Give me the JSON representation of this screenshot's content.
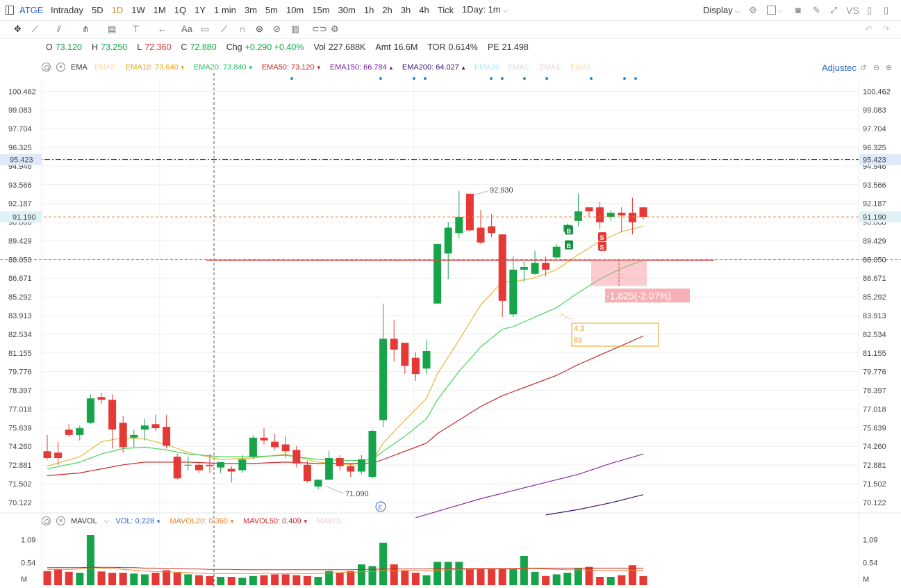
{
  "topbar": {
    "symbol": "ATGE",
    "timeframes": [
      "Intraday",
      "5D",
      "1D",
      "1W",
      "1M",
      "1Q",
      "1Y",
      "1 min",
      "3m",
      "5m",
      "10m",
      "15m",
      "30m",
      "1h",
      "2h",
      "3h",
      "4h",
      "Tick"
    ],
    "active_timeframe": "1D",
    "interval_select": "1Day: 1m",
    "display_label": "Display",
    "vs_label": "VS"
  },
  "ohlc": {
    "open_label": "O",
    "open": "73.120",
    "high_label": "H",
    "high": "73.250",
    "low_label": "L",
    "low": "72.360",
    "close_label": "C",
    "close": "72.880",
    "chg_label": "Chg",
    "chg": "+0.290",
    "chg_pct": "+0.40%",
    "vol_label": "Vol",
    "vol": "227.688K",
    "amt_label": "Amt",
    "amt": "16.6M",
    "tor_label": "TOR",
    "tor": "0.614%",
    "pe_label": "PE",
    "pe": "21.498"
  },
  "ema_legend": {
    "name": "EMA",
    "items": [
      {
        "label": "EMA5:",
        "value": "",
        "color": "#f5d9a8",
        "dir": ""
      },
      {
        "label": "EMA10:",
        "value": "73.640",
        "color": "#e8a317",
        "dir": "dn"
      },
      {
        "label": "EMA20:",
        "value": "73.840",
        "color": "#22c55e",
        "dir": "dn"
      },
      {
        "label": "EMA50:",
        "value": "73.120",
        "color": "#c62828",
        "dir": "dn"
      },
      {
        "label": "EMA150:",
        "value": "66.784",
        "color": "#7b1fa2",
        "dir": "up"
      },
      {
        "label": "EMA200:",
        "value": "64.027",
        "color": "#3b1670",
        "dir": "up"
      },
      {
        "label": "EMA30",
        "value": "",
        "color": "#b3e5f5",
        "dir": ""
      },
      {
        "label": "EMA1:",
        "value": "",
        "color": "#d8d8d8",
        "dir": ""
      },
      {
        "label": "EMA1:",
        "value": "",
        "color": "#e6cfe6",
        "dir": ""
      },
      {
        "label": "EMA1:",
        "value": "",
        "color": "#f5e0b0",
        "dir": ""
      }
    ],
    "adjusted_label": "Adjustec"
  },
  "vol_legend": {
    "name": "MAVOL",
    "items": [
      {
        "label": "VOL:",
        "value": "0.228",
        "color": "#2a62c9",
        "dir": "dn"
      },
      {
        "label": "MAVOL20:",
        "value": "0.360",
        "color": "#e8842c",
        "dir": "dn"
      },
      {
        "label": "MAVOL50:",
        "value": "0.409",
        "color": "#c62828",
        "dir": "dn"
      },
      {
        "label": "MAVOL:",
        "value": "",
        "color": "#f3c6e0",
        "dir": ""
      }
    ]
  },
  "colors": {
    "up": "#16a34a",
    "down": "#e53935",
    "grid": "#eeeeee"
  },
  "chart_data": {
    "type": "candlestick",
    "ylim": [
      69.4,
      101.3
    ],
    "y_ticks": [
      "100.462",
      "99.083",
      "97.704",
      "96.325",
      "94.946",
      "93.566",
      "92.187",
      "90.808",
      "89.429",
      "88.050",
      "86.671",
      "85.292",
      "83.913",
      "82.534",
      "81.155",
      "79.776",
      "78.397",
      "77.018",
      "75.639",
      "74.260",
      "72.881",
      "71.502",
      "70.122"
    ],
    "candles": [
      {
        "o": 73.9,
        "h": 75.1,
        "l": 73.3,
        "c": 73.4
      },
      {
        "o": 73.8,
        "h": 74.6,
        "l": 72.9,
        "c": 73.4
      },
      {
        "o": 75.5,
        "h": 75.9,
        "l": 75.0,
        "c": 75.1
      },
      {
        "o": 75.1,
        "h": 75.8,
        "l": 74.7,
        "c": 75.6
      },
      {
        "o": 76.0,
        "h": 78.1,
        "l": 75.9,
        "c": 77.8
      },
      {
        "o": 77.9,
        "h": 78.2,
        "l": 77.4,
        "c": 77.7
      },
      {
        "o": 77.7,
        "h": 78.1,
        "l": 74.1,
        "c": 75.5
      },
      {
        "o": 76.0,
        "h": 76.5,
        "l": 73.8,
        "c": 74.2
      },
      {
        "o": 74.9,
        "h": 75.5,
        "l": 74.2,
        "c": 75.1
      },
      {
        "o": 75.5,
        "h": 76.3,
        "l": 74.7,
        "c": 75.8
      },
      {
        "o": 75.9,
        "h": 76.6,
        "l": 75.4,
        "c": 75.6
      },
      {
        "o": 75.7,
        "h": 76.6,
        "l": 74.1,
        "c": 74.3
      },
      {
        "o": 73.5,
        "h": 73.7,
        "l": 71.8,
        "c": 71.9
      },
      {
        "o": 72.9,
        "h": 73.5,
        "l": 72.5,
        "c": 72.9
      },
      {
        "o": 72.9,
        "h": 73.1,
        "l": 72.3,
        "c": 72.5
      },
      {
        "o": 72.9,
        "h": 73.7,
        "l": 72.3,
        "c": 72.8
      },
      {
        "o": 72.7,
        "h": 73.1,
        "l": 72.3,
        "c": 73.1
      },
      {
        "o": 72.6,
        "h": 72.8,
        "l": 71.6,
        "c": 72.4
      },
      {
        "o": 72.5,
        "h": 73.6,
        "l": 72.3,
        "c": 73.3
      },
      {
        "o": 73.5,
        "h": 75.1,
        "l": 73.3,
        "c": 74.9
      },
      {
        "o": 74.9,
        "h": 75.6,
        "l": 74.4,
        "c": 74.7
      },
      {
        "o": 74.6,
        "h": 75.2,
        "l": 74.0,
        "c": 74.2
      },
      {
        "o": 74.4,
        "h": 75.0,
        "l": 73.4,
        "c": 73.9
      },
      {
        "o": 74.0,
        "h": 74.3,
        "l": 72.7,
        "c": 73.0
      },
      {
        "o": 72.9,
        "h": 73.2,
        "l": 71.6,
        "c": 71.7
      },
      {
        "o": 71.3,
        "h": 71.8,
        "l": 71.1,
        "c": 71.8
      },
      {
        "o": 71.8,
        "h": 73.9,
        "l": 71.8,
        "c": 73.4
      },
      {
        "o": 73.4,
        "h": 73.6,
        "l": 72.5,
        "c": 72.8
      },
      {
        "o": 72.8,
        "h": 73.0,
        "l": 72.0,
        "c": 72.4
      },
      {
        "o": 72.4,
        "h": 73.6,
        "l": 72.2,
        "c": 73.3
      },
      {
        "o": 72.0,
        "h": 75.5,
        "l": 71.9,
        "c": 75.4
      },
      {
        "o": 76.2,
        "h": 84.8,
        "l": 75.7,
        "c": 82.2
      },
      {
        "o": 82.2,
        "h": 83.6,
        "l": 80.5,
        "c": 81.4
      },
      {
        "o": 81.9,
        "h": 81.9,
        "l": 79.6,
        "c": 80.2
      },
      {
        "o": 80.8,
        "h": 81.2,
        "l": 79.1,
        "c": 79.6
      },
      {
        "o": 80.0,
        "h": 82.1,
        "l": 79.6,
        "c": 81.3
      },
      {
        "o": 84.8,
        "h": 89.2,
        "l": 84.8,
        "c": 89.2
      },
      {
        "o": 88.5,
        "h": 90.8,
        "l": 86.6,
        "c": 90.4
      },
      {
        "o": 90.0,
        "h": 93.1,
        "l": 89.6,
        "c": 91.2
      },
      {
        "o": 92.9,
        "h": 92.9,
        "l": 90.1,
        "c": 90.2
      },
      {
        "o": 90.4,
        "h": 91.7,
        "l": 89.2,
        "c": 89.3
      },
      {
        "o": 90.5,
        "h": 91.4,
        "l": 89.7,
        "c": 90.0
      },
      {
        "o": 89.9,
        "h": 89.9,
        "l": 83.8,
        "c": 85.0
      },
      {
        "o": 84.0,
        "h": 88.3,
        "l": 83.8,
        "c": 87.3
      },
      {
        "o": 87.3,
        "h": 87.9,
        "l": 86.4,
        "c": 87.5
      },
      {
        "o": 87.0,
        "h": 88.7,
        "l": 86.9,
        "c": 87.8
      },
      {
        "o": 87.8,
        "h": 88.3,
        "l": 86.8,
        "c": 87.3
      },
      {
        "o": 88.2,
        "h": 89.2,
        "l": 88.1,
        "c": 89.0
      },
      {
        "o": 90.1,
        "h": 90.7,
        "l": 89.9,
        "c": 90.6
      },
      {
        "o": 90.9,
        "h": 92.9,
        "l": 90.5,
        "c": 91.6
      },
      {
        "o": 91.9,
        "h": 91.9,
        "l": 91.2,
        "c": 91.6
      },
      {
        "o": 91.9,
        "h": 92.3,
        "l": 90.3,
        "c": 90.8
      },
      {
        "o": 91.2,
        "h": 91.7,
        "l": 90.9,
        "c": 91.5
      },
      {
        "o": 91.5,
        "h": 91.9,
        "l": 90.1,
        "c": 91.3
      },
      {
        "o": 91.5,
        "h": 92.6,
        "l": 89.9,
        "c": 90.8
      },
      {
        "o": 91.9,
        "h": 91.9,
        "l": 91.0,
        "c": 91.2
      }
    ],
    "ema_lines": [
      {
        "name": "EMA10",
        "color": "#e8b53a",
        "points": [
          [
            0,
            72.8
          ],
          [
            3,
            73.5
          ],
          [
            5,
            74.6
          ],
          [
            7,
            74.9
          ],
          [
            9,
            74.8
          ],
          [
            11,
            74.4
          ],
          [
            13,
            73.8
          ],
          [
            16,
            73.3
          ],
          [
            19,
            73.4
          ],
          [
            22,
            73.7
          ],
          [
            25,
            73.1
          ],
          [
            28,
            72.9
          ],
          [
            30,
            73.2
          ],
          [
            31,
            74.5
          ],
          [
            33,
            76.2
          ],
          [
            35,
            77.8
          ],
          [
            36,
            79.6
          ],
          [
            38,
            82.1
          ],
          [
            40,
            84.7
          ],
          [
            42,
            86.4
          ],
          [
            43,
            86.4
          ],
          [
            45,
            86.7
          ],
          [
            47,
            87.3
          ],
          [
            49,
            88.4
          ],
          [
            51,
            89.4
          ],
          [
            53,
            90.1
          ],
          [
            55,
            90.5
          ]
        ]
      },
      {
        "name": "EMA20",
        "color": "#46d65a",
        "points": [
          [
            0,
            72.6
          ],
          [
            3,
            73.1
          ],
          [
            5,
            73.7
          ],
          [
            7,
            74.1
          ],
          [
            9,
            74.2
          ],
          [
            11,
            74.0
          ],
          [
            13,
            73.7
          ],
          [
            16,
            73.5
          ],
          [
            19,
            73.5
          ],
          [
            22,
            73.6
          ],
          [
            25,
            73.3
          ],
          [
            28,
            73.2
          ],
          [
            30,
            73.3
          ],
          [
            31,
            73.9
          ],
          [
            33,
            75.0
          ],
          [
            35,
            76.3
          ],
          [
            36,
            77.7
          ],
          [
            38,
            79.8
          ],
          [
            40,
            81.6
          ],
          [
            42,
            82.9
          ],
          [
            43,
            83.1
          ],
          [
            45,
            83.8
          ],
          [
            47,
            84.5
          ],
          [
            49,
            85.6
          ],
          [
            51,
            86.6
          ],
          [
            53,
            87.4
          ],
          [
            55,
            88.0
          ]
        ]
      },
      {
        "name": "EMA50",
        "color": "#c62828",
        "points": [
          [
            0,
            72.1
          ],
          [
            3,
            72.3
          ],
          [
            5,
            72.6
          ],
          [
            7,
            72.9
          ],
          [
            9,
            73.1
          ],
          [
            11,
            73.1
          ],
          [
            13,
            73.1
          ],
          [
            16,
            73.0
          ],
          [
            19,
            73.0
          ],
          [
            22,
            73.1
          ],
          [
            25,
            73.0
          ],
          [
            28,
            73.0
          ],
          [
            30,
            73.0
          ],
          [
            31,
            73.3
          ],
          [
            33,
            73.9
          ],
          [
            35,
            74.5
          ],
          [
            36,
            75.2
          ],
          [
            38,
            76.2
          ],
          [
            40,
            77.2
          ],
          [
            42,
            78.0
          ],
          [
            43,
            78.3
          ],
          [
            45,
            78.9
          ],
          [
            47,
            79.5
          ],
          [
            49,
            80.3
          ],
          [
            51,
            81.0
          ],
          [
            53,
            81.7
          ],
          [
            55,
            82.4
          ]
        ]
      },
      {
        "name": "EMA150",
        "color": "#8e24aa",
        "points": [
          [
            34,
            69.0
          ],
          [
            37,
            69.7
          ],
          [
            40,
            70.4
          ],
          [
            43,
            71.0
          ],
          [
            46,
            71.6
          ],
          [
            49,
            72.2
          ],
          [
            52,
            73.0
          ],
          [
            55,
            73.7
          ]
        ]
      },
      {
        "name": "EMA200",
        "color": "#3b1670",
        "points": [
          [
            46,
            69.2
          ],
          [
            49,
            69.6
          ],
          [
            52,
            70.1
          ],
          [
            55,
            70.7
          ]
        ]
      }
    ],
    "volume": {
      "ylim": [
        0,
        1.2
      ],
      "y_ticks": [
        "1.09",
        "0.54",
        "M"
      ],
      "values": [
        0.34,
        0.38,
        0.32,
        0.3,
        1.2,
        0.33,
        0.3,
        0.3,
        0.28,
        0.26,
        0.3,
        0.36,
        0.3,
        0.26,
        0.24,
        0.22,
        0.2,
        0.2,
        0.18,
        0.22,
        0.24,
        0.26,
        0.26,
        0.24,
        0.22,
        0.2,
        0.34,
        0.3,
        0.34,
        0.5,
        0.46,
        1.02,
        0.5,
        0.36,
        0.3,
        0.24,
        0.56,
        0.56,
        0.56,
        0.4,
        0.4,
        0.4,
        0.4,
        0.4,
        0.7,
        0.32,
        0.22,
        0.26,
        0.3,
        0.4,
        0.44,
        0.2,
        0.2,
        0.24,
        0.48,
        0.22
      ],
      "mavol20": [
        0.38,
        0.38,
        0.38,
        0.39,
        0.42,
        0.41,
        0.4,
        0.38,
        0.36,
        0.34,
        0.33,
        0.32,
        0.31,
        0.3,
        0.29,
        0.28,
        0.28,
        0.28,
        0.28,
        0.28,
        0.29,
        0.28,
        0.28,
        0.28,
        0.28,
        0.28,
        0.29,
        0.3,
        0.31,
        0.32,
        0.33,
        0.35,
        0.35,
        0.35,
        0.35,
        0.35,
        0.36,
        0.37,
        0.38,
        0.38,
        0.39,
        0.39,
        0.39,
        0.39,
        0.4,
        0.4,
        0.39,
        0.38,
        0.37,
        0.37,
        0.36,
        0.35,
        0.35,
        0.35,
        0.36,
        0.36
      ],
      "mavol50": [
        0.42,
        0.42,
        0.42,
        0.42,
        0.43,
        0.43,
        0.43,
        0.42,
        0.42,
        0.41,
        0.41,
        0.4,
        0.4,
        0.39,
        0.39,
        0.38,
        0.38,
        0.38,
        0.37,
        0.37,
        0.37,
        0.37,
        0.37,
        0.37,
        0.37,
        0.37,
        0.37,
        0.37,
        0.37,
        0.38,
        0.38,
        0.39,
        0.39,
        0.39,
        0.39,
        0.39,
        0.4,
        0.4,
        0.4,
        0.4,
        0.4,
        0.4,
        0.4,
        0.4,
        0.41,
        0.41,
        0.41,
        0.41,
        0.41,
        0.41,
        0.41,
        0.41,
        0.41,
        0.41,
        0.41,
        0.41
      ]
    },
    "annotations": {
      "high_label": "92.930",
      "low_label": "71.090",
      "price_line_label": "95.423",
      "price_line_value": 95.423,
      "last_price_label": "91.190",
      "last_price_value": 91.19,
      "range_line_value": 88.05,
      "measure_label": "-1.825(-2.07%)",
      "box_line1": "4.3",
      "box_line2": "89",
      "buy_marker": "B",
      "sell_marker": "S",
      "event_marker": "E"
    }
  }
}
